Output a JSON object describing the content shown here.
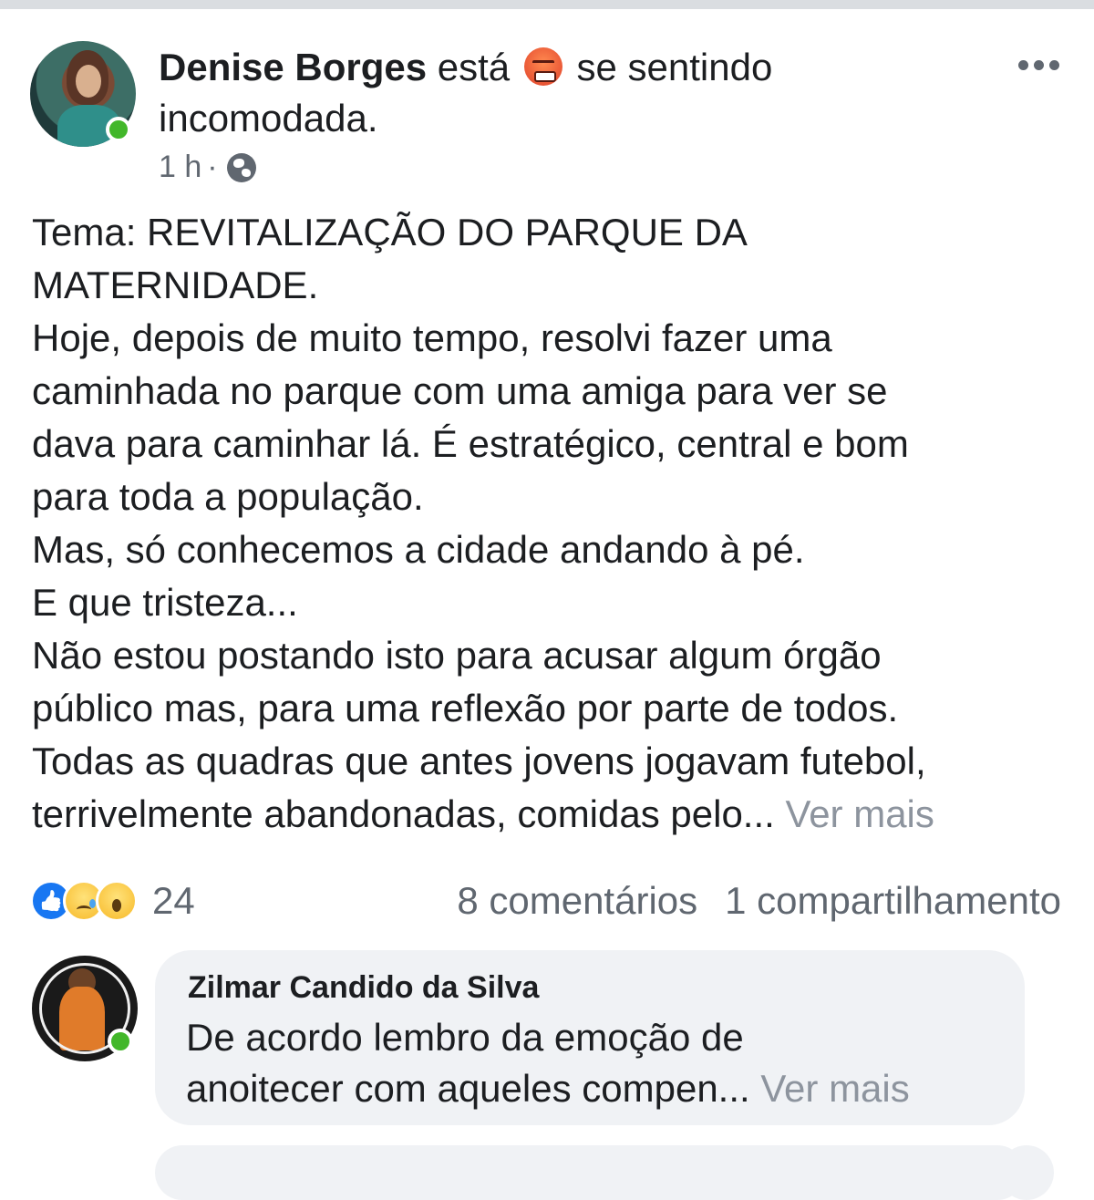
{
  "post": {
    "author": "Denise Borges",
    "feeling_prefix": "está",
    "feeling_icon": "angry-emoji-icon",
    "feeling_text": "se sentindo",
    "feeling_line2": "incomodada.",
    "time": "1 h",
    "separator": "·",
    "privacy_icon": "globe-icon",
    "more_icon": "more-options-icon",
    "body_lines": [
      "Tema: REVITALIZAÇÃO DO PARQUE DA",
      "MATERNIDADE.",
      "Hoje, depois de muito tempo, resolvi fazer uma",
      "caminhada no parque com uma amiga para ver se",
      "dava para caminhar lá. É estratégico, central e bom",
      "para toda a população.",
      "Mas, só conhecemos a cidade andando à pé.",
      "E que tristeza...",
      "Não estou postando isto para acusar algum órgão",
      "público mas, para uma reflexão por parte de todos.",
      "Todas as quadras que antes jovens jogavam futebol,",
      "terrivelmente abandonadas, comidas pelo..."
    ],
    "see_more": "Ver mais"
  },
  "reactions": {
    "icons": [
      "like-icon",
      "sad-icon",
      "wow-icon"
    ],
    "count": "24",
    "comments": "8 comentários",
    "shares": "1 compartilhamento"
  },
  "comment": {
    "author": "Zilmar Candido da Silva",
    "text_line1": "De acordo lembro da emoção de",
    "text_line2": "anoitecer com aqueles compen...",
    "see_more": "Ver mais"
  },
  "colors": {
    "online": "#42b72a",
    "secondary_text": "#606770",
    "bubble_bg": "#f0f2f5",
    "like_blue": "#1877f2"
  }
}
